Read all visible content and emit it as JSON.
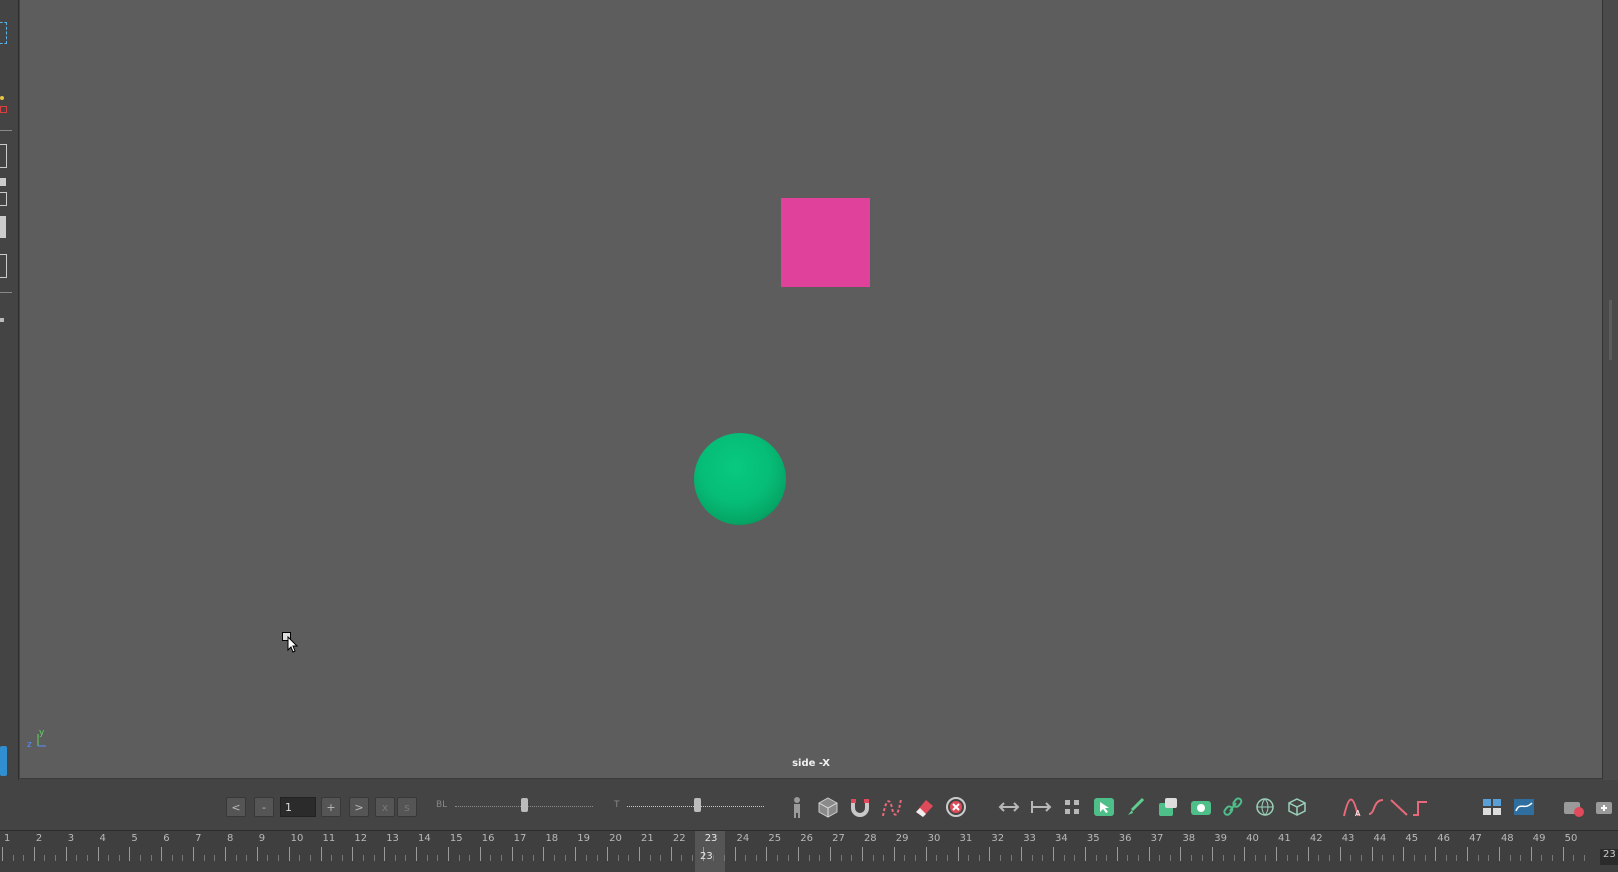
{
  "viewport": {
    "camera_label": "side -X",
    "axis": {
      "y": "y",
      "z": "z"
    },
    "colors": {
      "background": "#5d5d5d",
      "cube": "#e0429b",
      "sphere": "#06bd77"
    }
  },
  "playback": {
    "prev_label": "<",
    "minus_label": "-",
    "frame_value": "1",
    "plus_label": "+",
    "next_label": ">",
    "x_label": "x",
    "s_label": "s"
  },
  "sliders": {
    "bl_label": "BL",
    "t_label": "T"
  },
  "toolbar_icons": [
    "human-ik-icon",
    "cube-icon",
    "magnet-icon",
    "curve-tool-icon",
    "eraser-icon",
    "delete-icon",
    "arrows-horizontal-icon",
    "arrow-right-bar-icon",
    "grid-icon",
    "select-icon",
    "brush-icon",
    "paste-icon",
    "camera-icon",
    "link-icon",
    "globe-icon",
    "mesh-icon",
    "curve-a-icon",
    "curve-s-icon",
    "line-icon",
    "step-icon",
    "panel-icon",
    "graph-icon",
    "camera-record-icon",
    "add-icon"
  ],
  "timeline": {
    "start": 1,
    "end": 50,
    "current_frame": "23",
    "end_frame_label": "23",
    "tick_labels": [
      "1",
      "2",
      "3",
      "4",
      "5",
      "6",
      "7",
      "8",
      "9",
      "10",
      "11",
      "12",
      "13",
      "14",
      "15",
      "16",
      "17",
      "18",
      "19",
      "20",
      "21",
      "22",
      "23",
      "24",
      "25",
      "26",
      "27",
      "28",
      "29",
      "30",
      "31",
      "32",
      "33",
      "34",
      "35",
      "36",
      "37",
      "38",
      "39",
      "40",
      "41",
      "42",
      "43",
      "44",
      "45",
      "46",
      "47",
      "48",
      "49",
      "50"
    ]
  }
}
